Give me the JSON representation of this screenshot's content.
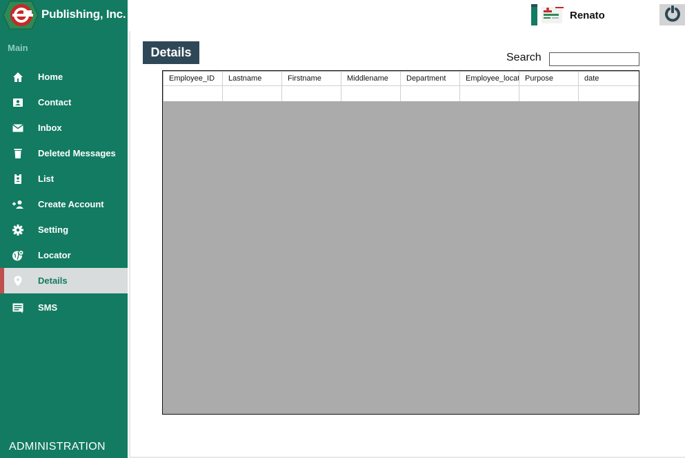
{
  "brand": {
    "name": "Publishing, Inc.",
    "logo_icon": "e-logo-icon"
  },
  "sidebar": {
    "section_title": "Main",
    "items": [
      {
        "label": "Home",
        "icon": "home-icon"
      },
      {
        "label": "Contact",
        "icon": "contact-card-icon"
      },
      {
        "label": "Inbox",
        "icon": "mail-icon"
      },
      {
        "label": "Deleted Messages",
        "icon": "trash-icon"
      },
      {
        "label": "List",
        "icon": "list-badge-icon"
      },
      {
        "label": "Create Account",
        "icon": "add-user-icon"
      },
      {
        "label": "Setting",
        "icon": "gear-icon"
      },
      {
        "label": "Locator",
        "icon": "globe-pin-icon"
      },
      {
        "label": "Details",
        "icon": "map-pin-icon",
        "active": true
      },
      {
        "label": "SMS",
        "icon": "sms-icon"
      }
    ],
    "footer_label": "ADMINISTRATION"
  },
  "header": {
    "user_name": "Renato",
    "avatar_icon": "user-card-icon",
    "power_icon": "power-icon"
  },
  "main": {
    "page_title": "Details",
    "search": {
      "label": "Search",
      "value": "",
      "placeholder": ""
    },
    "table": {
      "columns": [
        "Employee_ID",
        "Lastname",
        "Firstname",
        "Middlename",
        "Department",
        "Employee_locati",
        "Purpose",
        "date"
      ],
      "rows": [
        [
          "",
          "",
          "",
          "",
          "",
          "",
          "",
          ""
        ]
      ]
    }
  },
  "colors": {
    "sidebar_bg": "#127b62",
    "active_item_bg": "#d8dcdc",
    "active_marker": "#c0504d",
    "title_bg": "#2f4858",
    "grid_bg": "#ababab"
  }
}
